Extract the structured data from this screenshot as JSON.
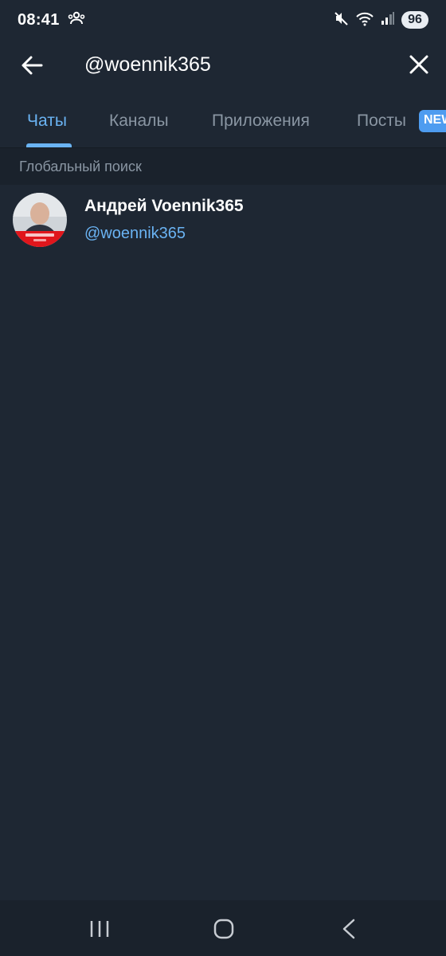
{
  "status_bar": {
    "time": "08:41",
    "battery": "96",
    "icons": [
      "people-icon",
      "mute-icon",
      "wifi-icon",
      "signal-icon"
    ]
  },
  "search": {
    "value": "@woennik365",
    "back_icon": "arrow-left-icon",
    "clear_icon": "close-icon"
  },
  "tabs": [
    {
      "label": "Чаты",
      "active": true
    },
    {
      "label": "Каналы",
      "active": false
    },
    {
      "label": "Приложения",
      "active": false
    },
    {
      "label": "Посты",
      "active": false,
      "badge": "NEW"
    }
  ],
  "section": {
    "title": "Глобальный поиск"
  },
  "results": [
    {
      "name": "Андрей Voennik365",
      "username": "@woennik365"
    }
  ],
  "nav_bar": {
    "icons": [
      "recent-apps-icon",
      "home-icon",
      "back-icon"
    ]
  },
  "colors": {
    "background": "#1e2733",
    "accent": "#6ab3f3",
    "muted": "#8a96a3",
    "badge": "#4e9cf0"
  }
}
